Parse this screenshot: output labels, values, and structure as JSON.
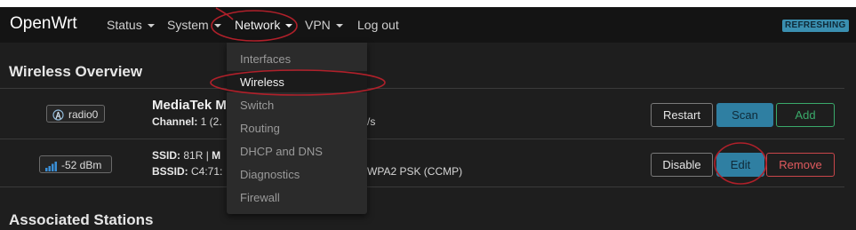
{
  "brand": "OpenWrt",
  "nav": {
    "status": "Status",
    "system": "System",
    "network": "Network",
    "vpn": "VPN",
    "logout": "Log out"
  },
  "badge": "REFRESHING",
  "wireless_overview": {
    "heading": "Wireless Overview",
    "radio": {
      "badge": "radio0",
      "title": "MediaTek M",
      "channel_label": "Channel:",
      "channel_value": " 1 (2.",
      "rate_fragment": "/s",
      "buttons": {
        "restart": "Restart",
        "scan": "Scan",
        "add": "Add"
      }
    },
    "network": {
      "signal": "-52 dBm",
      "ssid_label": "SSID:",
      "ssid_value": " 81R | ",
      "ssid_mode_fragment": "M",
      "bssid_label": "BSSID:",
      "bssid_value": " C4:71:",
      "encryption_fragment": "WPA2 PSK (CCMP)",
      "buttons": {
        "disable": "Disable",
        "edit": "Edit",
        "remove": "Remove"
      }
    }
  },
  "associated_stations": {
    "heading": "Associated Stations"
  },
  "network_menu": {
    "items": [
      "Interfaces",
      "Wireless",
      "Switch",
      "Routing",
      "DHCP and DNS",
      "Diagnostics",
      "Firewall"
    ],
    "active": "Wireless"
  },
  "colors": {
    "primary": "#2f7fa2",
    "success": "#3aaa6a",
    "danger": "#c9464a",
    "annotation": "#b0202a"
  },
  "icons": {
    "radio": "radio-tower-icon",
    "signal": "signal-strength-icon"
  }
}
